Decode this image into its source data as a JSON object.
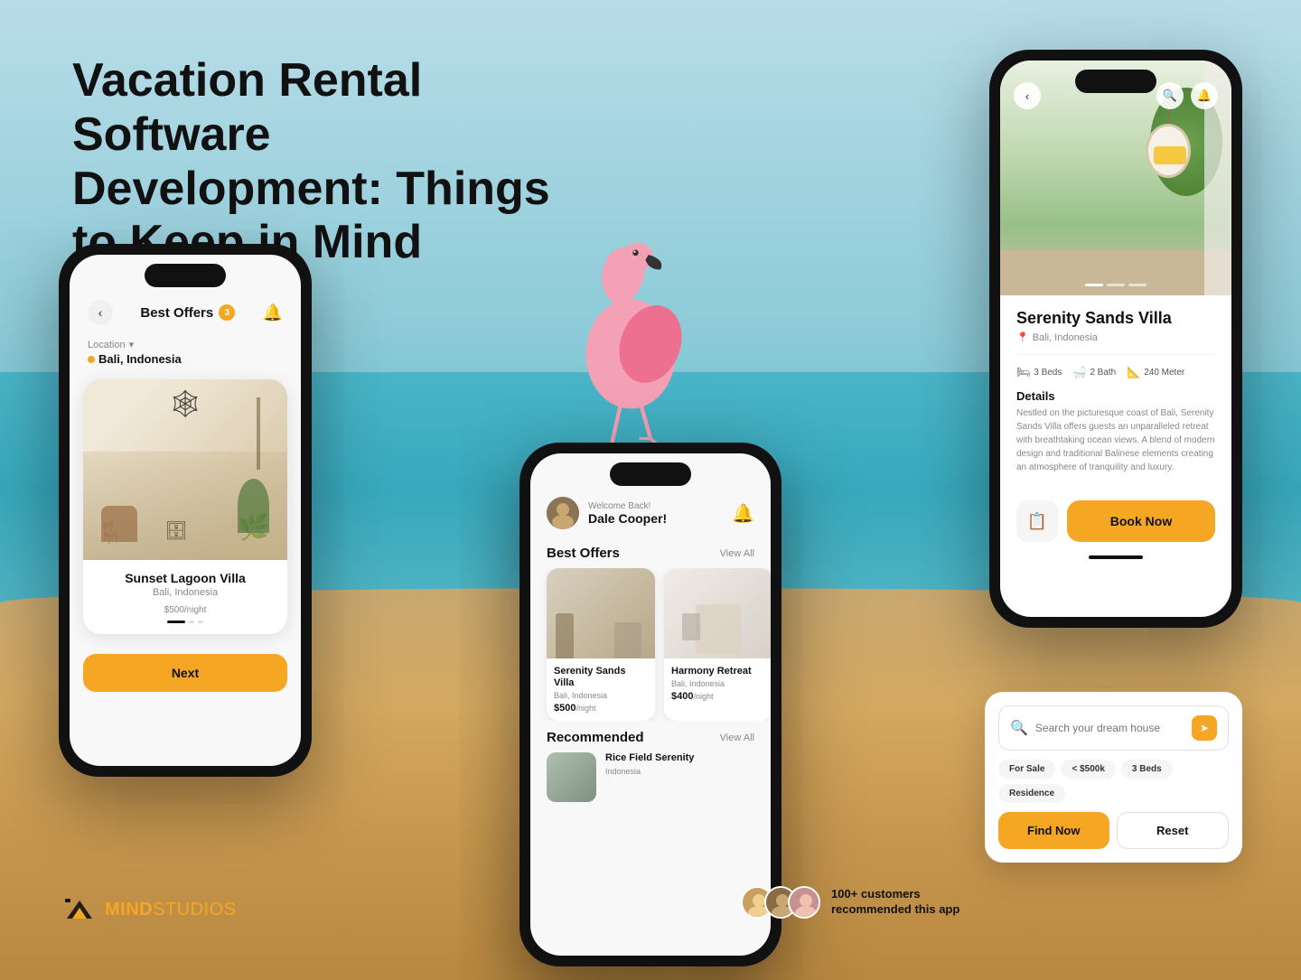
{
  "page": {
    "title": "Vacation Rental Software Development: Things to Keep in Mind",
    "background": "#a8d8e8"
  },
  "logo": {
    "name": "MINDSTUDIOS",
    "name_bold": "MIND",
    "name_rest": "STUDIOS"
  },
  "phone_left": {
    "header": {
      "back": "‹",
      "title": "Best Offers",
      "badge": "3",
      "bell": "🔔"
    },
    "location": {
      "label": "Location",
      "value": "Bali, Indonesia"
    },
    "property": {
      "name": "Sunset Lagoon Villa",
      "location": "Bali, Indonesia",
      "price": "$500",
      "price_unit": "/night"
    },
    "next_button": "Next"
  },
  "phone_center": {
    "welcome": "Welcome Back!",
    "user_name": "Dale Cooper!",
    "bell": "🔔",
    "best_offers": {
      "title": "Best Offers",
      "view_all": "View All",
      "cards": [
        {
          "name": "Serenity Sands Villa",
          "location": "Bali, Indonesia",
          "price": "$500",
          "price_unit": "/night"
        },
        {
          "name": "Harmony Retreat",
          "location": "Bali, Indonesia",
          "price": "$400",
          "price_unit": "/night"
        }
      ]
    },
    "recommended": {
      "title": "Recommended",
      "view_all": "View All",
      "cards": [
        {
          "name": "Rice Field Serenity",
          "location": "Indonesia"
        }
      ]
    }
  },
  "phone_right": {
    "property": {
      "name": "Serenity Sands Villa",
      "location": "Bali, Indonesia",
      "specs": {
        "beds": "3 Beds",
        "bath": "2 Bath",
        "size": "240 Meter"
      },
      "details_title": "Details",
      "description": "Nestled on the picturesque coast of Bali, Serenity Sands Villa offers guests an unparalleled retreat with breathtaking ocean views. A blend of modern design and traditional Balinese elements creating an atmosphere of tranquility and luxury."
    },
    "book_now": "Book Now"
  },
  "search_widget": {
    "placeholder": "Search your dream house",
    "tags": [
      "For Sale",
      "< $500k",
      "3 Beds",
      "Residence"
    ],
    "find_button": "Find Now",
    "reset_button": "Reset"
  },
  "testimonials": {
    "text": "100+ customers recommended this app"
  }
}
